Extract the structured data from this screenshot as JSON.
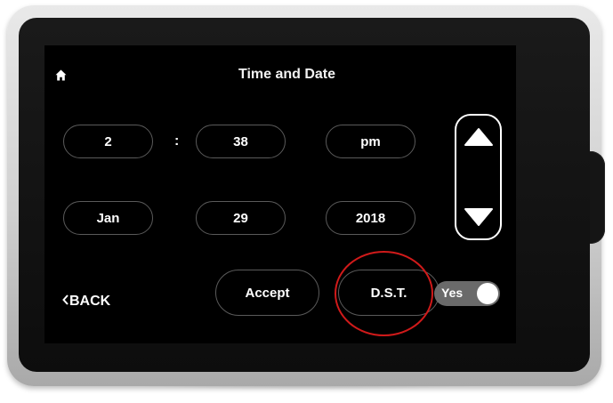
{
  "screen": {
    "title": "Time and Date",
    "home_icon": "home-icon"
  },
  "time": {
    "hour": "2",
    "separator": ":",
    "minute": "38",
    "ampm": "pm"
  },
  "date": {
    "month": "Jan",
    "day": "29",
    "year": "2018"
  },
  "adjust": {
    "up_icon": "triangle-up-icon",
    "down_icon": "triangle-down-icon"
  },
  "footer": {
    "back_label": "BACK",
    "accept_label": "Accept",
    "dst_label": "D.S.T.",
    "dst_toggle_label": "Yes",
    "dst_enabled": true
  },
  "colors": {
    "annotation_circle": "#d01a1a",
    "toggle_on": "#6a6a6a"
  }
}
